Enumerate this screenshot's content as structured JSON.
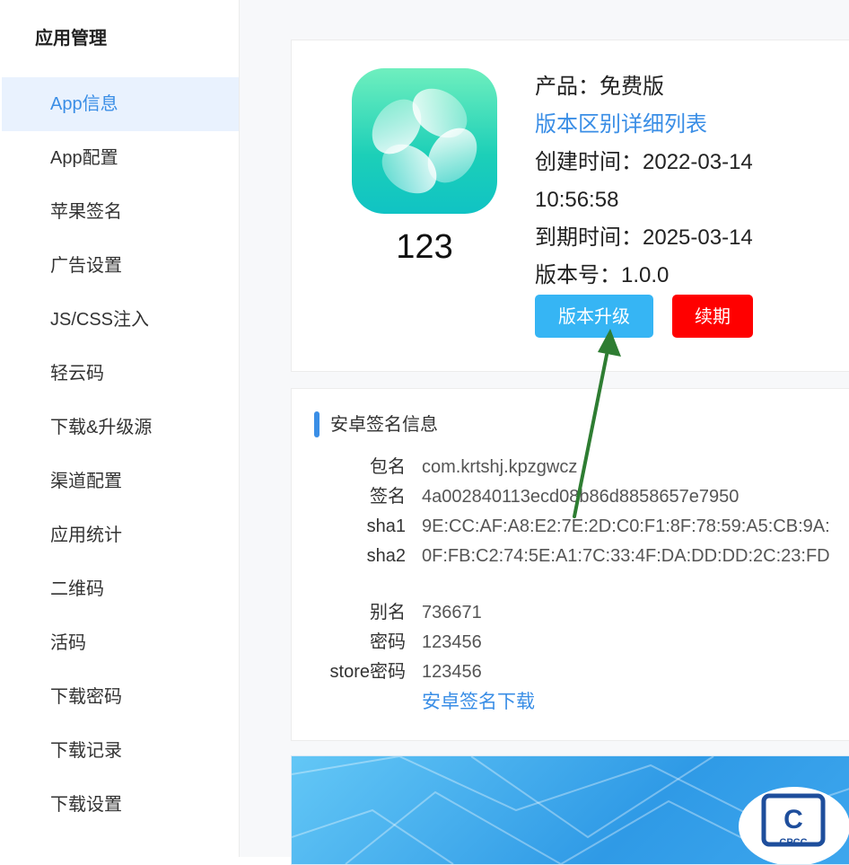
{
  "sidebar": {
    "title": "应用管理",
    "items": [
      {
        "label": "App信息",
        "active": true
      },
      {
        "label": "App配置"
      },
      {
        "label": "苹果签名"
      },
      {
        "label": "广告设置"
      },
      {
        "label": "JS/CSS注入"
      },
      {
        "label": "轻云码"
      },
      {
        "label": "下载&升级源"
      },
      {
        "label": "渠道配置"
      },
      {
        "label": "应用统计"
      },
      {
        "label": "二维码"
      },
      {
        "label": "活码"
      },
      {
        "label": "下载密码"
      },
      {
        "label": "下载记录"
      },
      {
        "label": "下载设置"
      }
    ]
  },
  "app": {
    "name": "123",
    "product": "产品：免费版",
    "version_diff_link": "版本区别详细列表",
    "created_label": "创建时间：2022-03-14",
    "created_time": "10:56:58",
    "expire": "到期时间：2025-03-14",
    "version": "版本号：1.0.0",
    "upgrade_button": "版本升级",
    "renew_button": "续期"
  },
  "signing": {
    "title": "安卓签名信息",
    "rows": [
      {
        "label": "包名",
        "value": "com.krtshj.kpzgwcz"
      },
      {
        "label": "签名",
        "value": "4a002840113ecd08b86d8858657e7950"
      },
      {
        "label": "sha1",
        "value": "9E:CC:AF:A8:E2:7E:2D:C0:F1:8F:78:59:A5:CB:9A:"
      },
      {
        "label": "sha2",
        "value": "0F:FB:C2:74:5E:A1:7C:33:4F:DA:DD:DD:2C:23:FD"
      },
      {
        "label": "别名",
        "value": "736671"
      },
      {
        "label": "密码",
        "value": "123456"
      },
      {
        "label": "store密码",
        "value": "123456"
      }
    ],
    "download_link": "安卓签名下载"
  },
  "banner": {
    "logo_text": "CPCC",
    "logo_letter": "C"
  },
  "colors": {
    "accent": "#3a8ee6",
    "upgrade": "#36b5f4",
    "renew": "#ff0000",
    "annotation_arrow": "#2e7d32"
  }
}
